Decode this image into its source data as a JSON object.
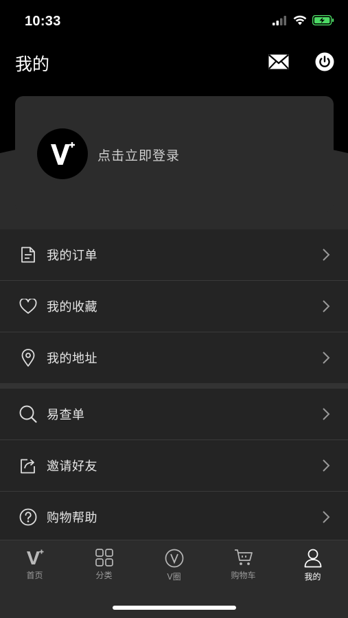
{
  "status_bar": {
    "time": "10:33"
  },
  "header": {
    "title": "我的",
    "mail_icon": "mail-icon",
    "power_icon": "power-icon"
  },
  "login_card": {
    "avatar_text": "V",
    "login_text": "点击立即登录"
  },
  "menu_group_1": [
    {
      "label": "我的订单",
      "icon": "document-icon"
    },
    {
      "label": "我的收藏",
      "icon": "heart-icon"
    },
    {
      "label": "我的地址",
      "icon": "location-pin-icon"
    }
  ],
  "menu_group_2": [
    {
      "label": "易查单",
      "icon": "search-icon"
    },
    {
      "label": "邀请好友",
      "icon": "share-icon"
    },
    {
      "label": "购物帮助",
      "icon": "help-icon"
    }
  ],
  "tabbar": {
    "items": [
      {
        "label": "首页",
        "icon": "v-logo-icon"
      },
      {
        "label": "分类",
        "icon": "grid-icon"
      },
      {
        "label": "V圈",
        "icon": "v-circle-icon"
      },
      {
        "label": "购物车",
        "icon": "cart-icon"
      },
      {
        "label": "我的",
        "icon": "user-icon",
        "active": true
      }
    ]
  },
  "colors": {
    "background": "#2c2c2c",
    "header_bg": "#000000",
    "menu_bg": "#242424",
    "text": "#e6e6e6",
    "muted": "#9a9a9a"
  }
}
